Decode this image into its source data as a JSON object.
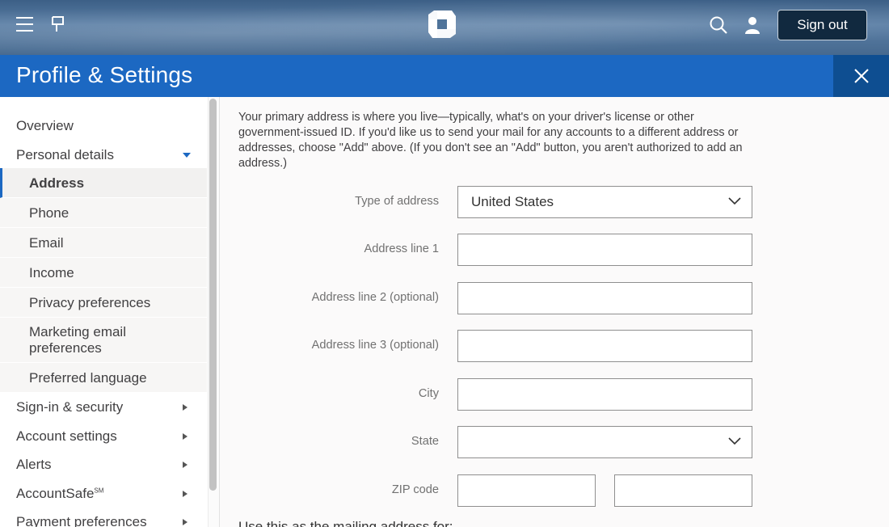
{
  "header": {
    "menu_icon": "hamburger-icon",
    "flag_icon": "flag-icon",
    "logo_icon": "chase-octagon-logo",
    "search_icon": "search-icon",
    "user_icon": "user-icon",
    "sign_out_label": "Sign out"
  },
  "titlebar": {
    "title": "Profile & Settings",
    "close_icon": "close-icon"
  },
  "sidebar": {
    "items": [
      {
        "label": "Overview",
        "arrow": "none"
      },
      {
        "label": "Personal details",
        "arrow": "down"
      },
      {
        "label": "Sign-in & security",
        "arrow": "right"
      },
      {
        "label": "Account settings",
        "arrow": "right"
      },
      {
        "label": "Alerts",
        "arrow": "right"
      },
      {
        "label": "AccountSafe",
        "sup": "SM",
        "arrow": "right"
      },
      {
        "label": "Payment preferences",
        "arrow": "right"
      }
    ],
    "sub_items": [
      {
        "label": "Address",
        "active": true
      },
      {
        "label": "Phone"
      },
      {
        "label": "Email"
      },
      {
        "label": "Income"
      },
      {
        "label": "Privacy preferences"
      },
      {
        "label": "Marketing email preferences"
      },
      {
        "label": "Preferred language"
      }
    ]
  },
  "main": {
    "intro": "Your primary address is where you live—typically, what's on your driver's license or other government-issued ID. If you'd like us to send your mail for any accounts to a different address or addresses, choose \"Add\" above. (If you don't see an \"Add\" button, you aren't authorized to add an address.)",
    "fields": {
      "type_of_address": {
        "label": "Type of address",
        "value": "United States"
      },
      "address_line_1": {
        "label": "Address line 1",
        "value": ""
      },
      "address_line_2": {
        "label": "Address line 2 (optional)",
        "value": ""
      },
      "address_line_3": {
        "label": "Address line 3 (optional)",
        "value": ""
      },
      "city": {
        "label": "City",
        "value": ""
      },
      "state": {
        "label": "State",
        "value": ""
      },
      "zip": {
        "label": "ZIP code",
        "value": "",
        "extension": ""
      }
    },
    "mailing_heading": "Use this as the mailing address for:"
  },
  "colors": {
    "header_bg": "#46698f",
    "title_bar": "#1c68c2",
    "close_bg": "#0e4e91",
    "sign_out_bg": "#11293f",
    "accent": "#1c68c2"
  }
}
